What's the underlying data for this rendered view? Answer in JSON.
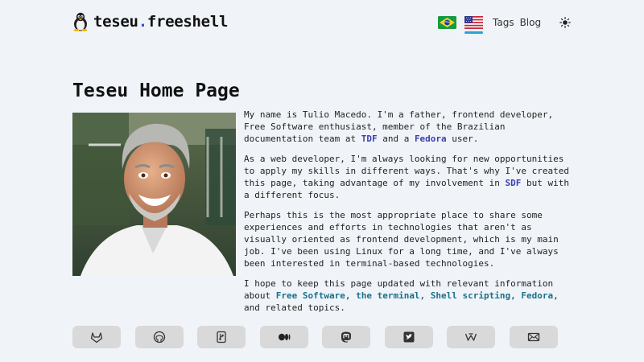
{
  "header": {
    "brand_name": "teseu",
    "brand_dot": ".",
    "brand_suffix": "freeshell",
    "nav_tags": "Tags",
    "nav_blog": "Blog"
  },
  "main": {
    "title": "Teseu Home Page",
    "paragraphs": {
      "p1_a": "My name is Tulio Macedo. I'm a father, frontend developer, Free Software enthusiast, member of the Brazilian documentation team at ",
      "p1_link1": "TDF",
      "p1_b": " and a ",
      "p1_link2": "Fedora",
      "p1_c": " user.",
      "p2_a": "As a web developer, I'm always looking for new opportunities to apply my skills in different ways. That's why I've created this page, taking advantage of my involvement in ",
      "p2_link": "SDF",
      "p2_b": " but with a different focus.",
      "p3": "Perhaps this is the most appropriate place to share some experiences and efforts in technologies that aren't as visually oriented as frontend development, which is my main job. I've been using Linux for a long time, and I've always been interested in terminal-based technologies.",
      "p4_a": "I hope to keep this page updated with relevant information about ",
      "p4_link": "Free Software, the terminal, Shell scripting, Fedora",
      "p4_b": ", and related topics."
    }
  },
  "socials": [
    {
      "icon": "gitlab-icon"
    },
    {
      "icon": "github-icon"
    },
    {
      "icon": "git-icon"
    },
    {
      "icon": "medium-icon"
    },
    {
      "icon": "mastodon-icon"
    },
    {
      "icon": "twitter-icon"
    },
    {
      "icon": "wordpress-icon"
    },
    {
      "icon": "email-icon"
    }
  ],
  "colors": {
    "background": "#f0f4f8",
    "accent": "#3b4fd1",
    "link": "#3b3fb0",
    "link_teal": "#1b6f8a",
    "active_flag_underline": "#29a3d6"
  }
}
